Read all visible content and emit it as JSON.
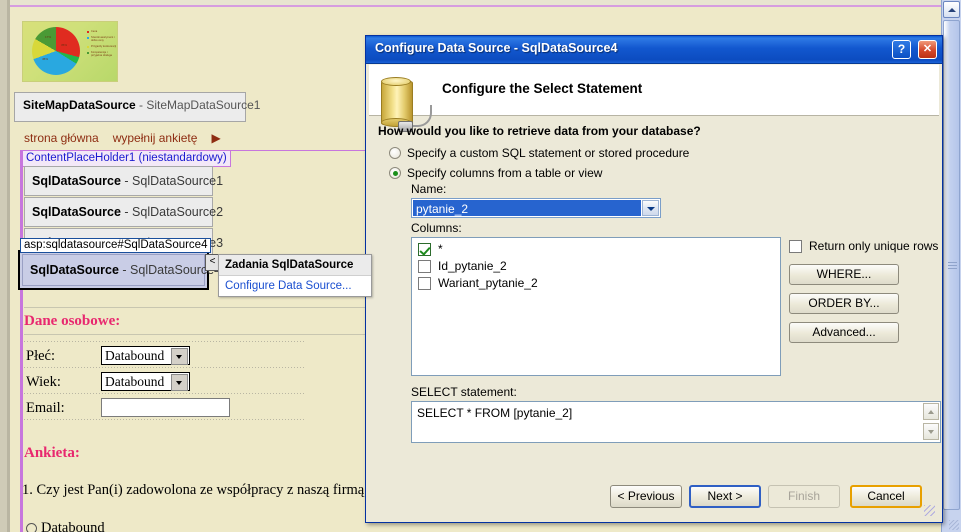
{
  "designer": {
    "banner": {
      "name": "pie-chart-banner",
      "pie_labels": [
        "35%",
        "17%",
        "45%"
      ],
      "legend": [
        {
          "color": "#e02b20",
          "label": "Cena"
        },
        {
          "color": "#29a8e0",
          "label": "Szeroki asortyment i dobre ceny"
        },
        {
          "color": "#d8d83a",
          "label": "Przyjazdy konkurencji"
        },
        {
          "color": "#4a9a35",
          "label": "Kompetencje i przyjazna obsluga"
        }
      ]
    },
    "sitemap_datasource": {
      "type": "SiteMapDataSource",
      "id": "SiteMapDataSource1"
    },
    "sitemap_path": [
      "strona główna",
      "wypełnij ankietę"
    ],
    "content_placeholder": "ContentPlaceHolder1 (niestandardowy)",
    "datasources": [
      {
        "type": "SqlDataSource",
        "id": "SqlDataSource1"
      },
      {
        "type": "SqlDataSource",
        "id": "SqlDataSource2"
      },
      {
        "type": "SqlDataSource",
        "id": "SqlDataSource3"
      },
      {
        "type": "SqlDataSource",
        "id": "SqlDataSource4"
      }
    ],
    "tag_hint": "asp:sqldatasource#SqlDataSource4",
    "smart_tag": {
      "chevron": "<",
      "header": "Zadania SqlDataSource",
      "items": [
        "Configure Data Source..."
      ]
    },
    "form": {
      "section_title": "Dane osobowe:",
      "fields": [
        {
          "label": "Płeć:",
          "control": "dropdown",
          "value": "Databound"
        },
        {
          "label": "Wiek:",
          "control": "dropdown",
          "value": "Databound"
        },
        {
          "label": "Email:",
          "control": "textbox",
          "value": ""
        }
      ],
      "survey_title": "Ankieta:",
      "question": "1. Czy jest Pan(i) zadowolona ze współpracy z naszą firmą",
      "option": "Databound"
    }
  },
  "dialog": {
    "title": "Configure Data Source - SqlDataSource4",
    "help_button": "?",
    "close_button": "✕",
    "icon": "database-plug-icon",
    "header": "Configure the Select Statement",
    "question": "How would you like to retrieve data from your database?",
    "radios": [
      {
        "label": "Specify a custom SQL statement or stored procedure",
        "selected": false
      },
      {
        "label": "Specify columns from a table or view",
        "selected": true
      }
    ],
    "name_label": "Name:",
    "name_value": "pytanie_2",
    "columns_label": "Columns:",
    "columns": [
      {
        "label": "*",
        "checked": true
      },
      {
        "label": "Id_pytanie_2",
        "checked": false
      },
      {
        "label": "Wariant_pytanie_2",
        "checked": false
      }
    ],
    "unique_rows": {
      "label": "Return only unique rows",
      "checked": false
    },
    "side_buttons": [
      "WHERE...",
      "ORDER BY...",
      "Advanced..."
    ],
    "select_label": "SELECT statement:",
    "select_statement": "SELECT * FROM [pytanie_2]",
    "footer_buttons": [
      {
        "label": "< Previous",
        "state": "normal"
      },
      {
        "label": "Next >",
        "state": "focus"
      },
      {
        "label": "Finish",
        "state": "disabled"
      },
      {
        "label": "Cancel",
        "state": "default"
      }
    ]
  },
  "scrollbar": {
    "up_arrow": "▲"
  },
  "colors": {
    "title_blue": "#0b4fc4",
    "dialog_face": "#ece9d8",
    "page_yellow": "#eee9c8",
    "accent_pink": "#e8286f",
    "link_blue": "#1a4fd0"
  }
}
